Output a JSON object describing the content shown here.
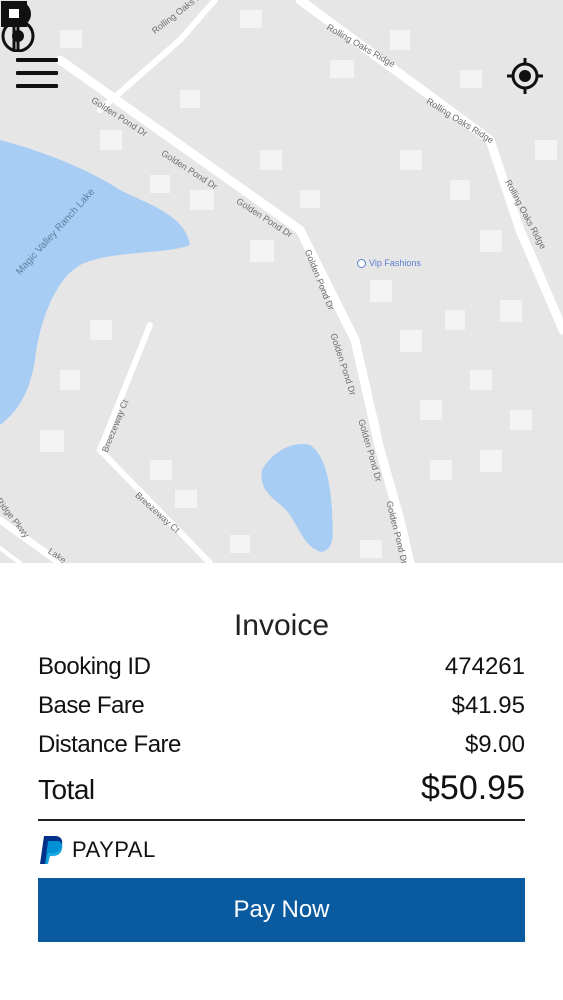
{
  "map": {
    "streets": [
      "Rolling Oaks Ridge",
      "Rolling Oaks Ridge",
      "Rolling Oaks Ridge",
      "Rolling Oaks Ridge",
      "Golden Pond Dr",
      "Golden Pond Dr",
      "Golden Pond Dr",
      "Golden Pond Dr",
      "Golden Pond Dr",
      "Golden Pond Dr",
      "Golden Pond Dr",
      "Breezeway Ct",
      "Breezeway Ct",
      "Ridge Pkwy",
      "Lake"
    ],
    "lake_label": "Magic Valley Ranch Lake",
    "poi_label": "Vip Fashions",
    "colors": {
      "land": "#e6e6e6",
      "road": "#ffffff",
      "water": "#a8cdf5",
      "building": "#f4f4f4"
    }
  },
  "controls": {
    "menu_icon": "hamburger-menu-icon",
    "locate_icon": "my-location-icon"
  },
  "invoice": {
    "title": "Invoice",
    "rows": [
      {
        "label": "Booking ID",
        "value": "474261"
      },
      {
        "label": "Base Fare",
        "value": "$41.95"
      },
      {
        "label": "Distance Fare",
        "value": "$9.00"
      }
    ],
    "total": {
      "label": "Total",
      "value": "$50.95"
    },
    "payment_method": "PAYPAL",
    "pay_button": "Pay Now",
    "colors": {
      "button": "#0a5aa0",
      "paypal_dark": "#003087",
      "paypal_light": "#009cde"
    }
  }
}
